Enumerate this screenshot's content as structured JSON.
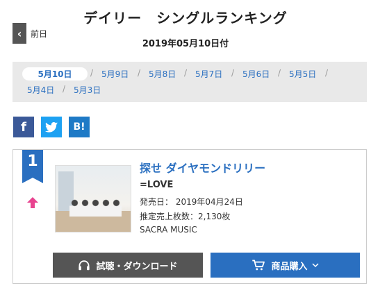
{
  "header": {
    "title": "デイリー　シングルランキング",
    "date": "2019年05月10日付",
    "prev_label": "前日"
  },
  "dates": {
    "current": "5月10日",
    "row1": [
      "5月9日",
      "5月8日",
      "5月7日",
      "5月6日",
      "5月5日"
    ],
    "row2": [
      "5月4日",
      "5月3日"
    ],
    "separator": "/"
  },
  "social": {
    "facebook": "f",
    "twitter": "twitter-bird",
    "hatena": "B!"
  },
  "entry": {
    "rank": "1",
    "trend": "up",
    "title": "探せ ダイヤモンドリリー",
    "artist": "=LOVE",
    "release": "発売日： 2019年04月24日",
    "sales": "推定売上枚数：2,130枚",
    "label": "SACRA MUSIC",
    "download_label": "試聴・ダウンロード",
    "buy_label": "商品購入"
  },
  "colors": {
    "accent": "#2a6fc0",
    "trend_up": "#e8438f",
    "dark_button": "#555555"
  }
}
